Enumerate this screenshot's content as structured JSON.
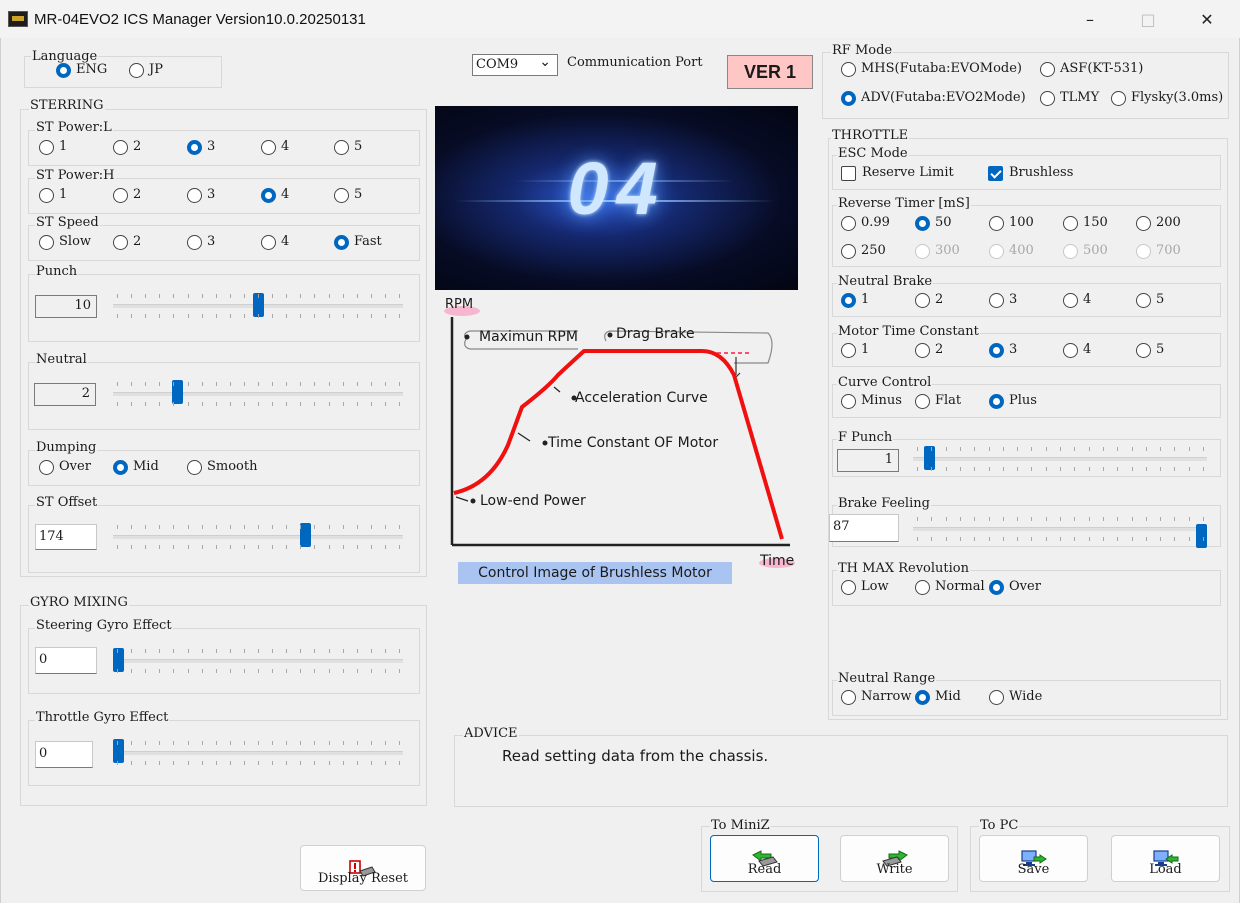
{
  "window": {
    "title": "MR-04EVO2 ICS Manager Version10.0.20250131",
    "minimize": "–",
    "maximize": "□",
    "close": "✕"
  },
  "language": {
    "title": "Language",
    "options": [
      "ENG",
      "JP"
    ],
    "selected": "ENG"
  },
  "comm": {
    "port": "COM9",
    "label": "Communication Port"
  },
  "version_badge": "VER 1",
  "rf_mode": {
    "title": "RF Mode",
    "options": [
      "MHS(Futaba:EVOMode)",
      "ASF(KT-531)",
      "ADV(Futaba:EVO2Mode)",
      "TLMY",
      "Flysky(3.0ms)"
    ],
    "selected": "ADV(Futaba:EVO2Mode)"
  },
  "steering": {
    "title": "STERRING",
    "power_l": {
      "title": "ST Power:L",
      "options": [
        "1",
        "2",
        "3",
        "4",
        "5"
      ],
      "selected": "3"
    },
    "power_h": {
      "title": "ST Power:H",
      "options": [
        "1",
        "2",
        "3",
        "4",
        "5"
      ],
      "selected": "4"
    },
    "speed": {
      "title": "ST Speed",
      "options": [
        "Slow",
        "2",
        "3",
        "4",
        "Fast"
      ],
      "selected": "Fast"
    },
    "punch": {
      "title": "Punch",
      "value": "10",
      "level": 0.5
    },
    "neutral": {
      "title": "Neutral",
      "value": "2",
      "level": 0.21
    },
    "dumping": {
      "title": "Dumping",
      "options": [
        "Over",
        "Mid",
        "Smooth"
      ],
      "selected": "Mid"
    },
    "offset": {
      "title": "ST Offset",
      "value": "174",
      "level": 0.67
    }
  },
  "gyro": {
    "title": "GYRO MIXING",
    "steering": {
      "title": "Steering Gyro Effect",
      "value": "0",
      "level": 0
    },
    "throttle": {
      "title": "Throttle Gyro Effect",
      "value": "0",
      "level": 0
    }
  },
  "diagram": {
    "y_axis": "RPM",
    "x_axis": "Time",
    "labels": {
      "max_rpm": "Maximun RPM",
      "drag_brake": "Drag Brake",
      "accel": "Acceleration Curve",
      "time_const": "Time Constant OF Motor",
      "low_end": "Low-end Power"
    },
    "caption": "Control Image of Brushless Motor",
    "line_color": "#f01010"
  },
  "throttle": {
    "title": "THROTTLE",
    "esc": {
      "title": "ESC Mode",
      "reserve_limit": "Reserve Limit",
      "brushless": "Brushless",
      "brushless_checked": true,
      "reserve_checked": false
    },
    "reverse_timer": {
      "title": "Reverse Timer [mS]",
      "options": [
        "0.99",
        "50",
        "100",
        "150",
        "200",
        "250",
        "300",
        "400",
        "500",
        "700"
      ],
      "selected": "50"
    },
    "neutral_brake": {
      "title": "Neutral Brake",
      "options": [
        "1",
        "2",
        "3",
        "4",
        "5"
      ],
      "selected": "1"
    },
    "motor_time": {
      "title": "Motor Time Constant",
      "options": [
        "1",
        "2",
        "3",
        "4",
        "5"
      ],
      "selected": "3"
    },
    "curve": {
      "title": "Curve Control",
      "options": [
        "Minus",
        "Flat",
        "Plus"
      ],
      "selected": "Plus"
    },
    "f_punch": {
      "title": "F Punch",
      "value": "1",
      "level": 0.04
    },
    "brake_feeling": {
      "title": "Brake Feeling",
      "value": "87",
      "level": 1.0
    },
    "th_max": {
      "title": "TH MAX Revolution",
      "options": [
        "Low",
        "Normal",
        "Over"
      ],
      "selected": "Over"
    },
    "neutral_range": {
      "title": "Neutral Range",
      "options": [
        "Narrow",
        "Mid",
        "Wide"
      ],
      "selected": "Mid"
    }
  },
  "advice": {
    "title": "ADVICE",
    "text": "Read setting data from the chassis."
  },
  "buttons": {
    "display_reset": "Display Reset",
    "to_miniz": "To MiniZ",
    "to_pc": "To PC",
    "read": "Read",
    "write": "Write",
    "save": "Save",
    "load": "Load"
  }
}
